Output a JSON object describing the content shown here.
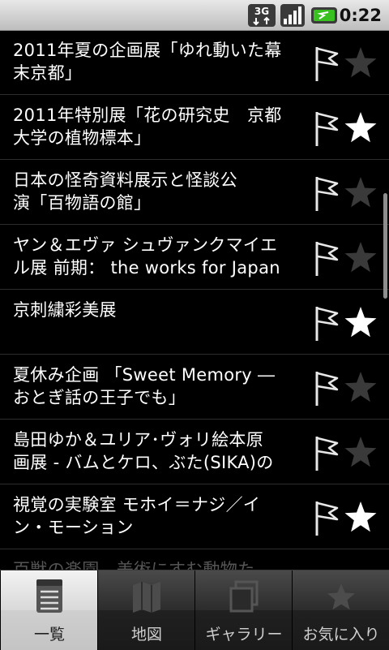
{
  "status_bar": {
    "network_badge": "3G",
    "time": "0:22"
  },
  "list": {
    "items": [
      {
        "title": "2011年夏の企画展「ゆれ動いた幕末京都」",
        "line1": "2011年夏の企画展「ゆれ動いた幕",
        "line2": "末京都」",
        "starred": false
      },
      {
        "title": "2011年特別展「花の研究史　京都大学の植物標本」",
        "line1": "2011年特別展「花の研究史　京都",
        "line2": "大学の植物標本」",
        "starred": true
      },
      {
        "title": "日本の怪奇資料展示と怪談公演「百物語の館」",
        "line1": "日本の怪奇資料展示と怪談公",
        "line2": "演「百物語の館」",
        "starred": false
      },
      {
        "title": "ヤン＆エヴァ シュヴァンクマイエル展 前期： the works for Japan",
        "line1": "ヤン＆エヴァ シュヴァンクマイエ",
        "line2": "ル展 前期： the works for Japan",
        "starred": false
      },
      {
        "title": "京刺繍彩美展",
        "line1": "京刺繍彩美展",
        "line2": "",
        "starred": true
      },
      {
        "title": "夏休み企画 「Sweet Memory ― おとぎ話の王子でも」",
        "line1": "夏休み企画 「Sweet Memory ―",
        "line2": "おとぎ話の王子でも」",
        "starred": false
      },
      {
        "title": "島田ゆか＆ユリア･ヴォリ絵本原画展 - バムとケロ、ぶた(SIKA)の",
        "line1": "島田ゆか＆ユリア･ヴォリ絵本原",
        "line2": "画展  - バムとケロ、ぶた(SIKA)の",
        "starred": false
      },
      {
        "title": "視覚の実験室 モホイ＝ナジ／イン・モーション",
        "line1": "視覚の実験室 モホイ＝ナジ／イ",
        "line2": "ン・モーション",
        "starred": true
      },
      {
        "title": "百獣の楽園　美術にすむ動物た",
        "line1": "百獣の楽園　美術にすむ動物た",
        "line2": "",
        "starred": false
      }
    ]
  },
  "tabs": [
    {
      "label": "一覧",
      "icon": "list-icon",
      "active": true
    },
    {
      "label": "地図",
      "icon": "map-icon",
      "active": false
    },
    {
      "label": "ギャラリー",
      "icon": "gallery-icon",
      "active": false
    },
    {
      "label": "お気に入り",
      "icon": "favorites-star-icon",
      "active": false
    }
  ],
  "colors": {
    "background": "#000000",
    "star_on": "#ffffff",
    "star_off": "#3a3a3a",
    "tab_active": "#d9d9d9",
    "battery_green": "#38c020"
  }
}
